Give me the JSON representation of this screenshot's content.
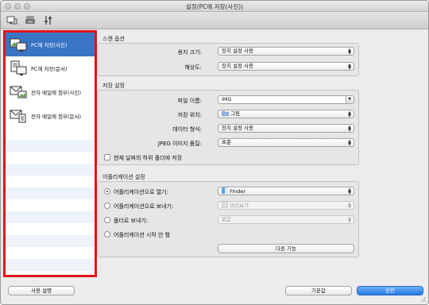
{
  "window": {
    "title": "설정(PC에 저장(사진))"
  },
  "colors": {
    "accent": "#3a75c4",
    "highlight_frame": "#e0151a"
  },
  "toolbar": {
    "icons": [
      "scan-from-computer-icon",
      "scan-from-operation-panel-icon",
      "general-settings-icon"
    ]
  },
  "sidebar": {
    "items": [
      {
        "label": "PC에 저장(사진)",
        "icon": "save-photo-icon",
        "selected": true
      },
      {
        "label": "PC에 저장(문서)",
        "icon": "save-document-icon",
        "selected": false
      },
      {
        "label": "전자 메일에 첨부(사진)",
        "icon": "email-photo-icon",
        "selected": false
      },
      {
        "label": "전자 메일에 첨부(문서)",
        "icon": "email-document-icon",
        "selected": false
      }
    ]
  },
  "scan_options": {
    "title": "스캔 옵션",
    "paper_size_label": "용지 크기:",
    "paper_size_value": "장치 설정 사용",
    "resolution_label": "해상도:",
    "resolution_value": "장치 설정 사용"
  },
  "save_settings": {
    "title": "저장 설정",
    "file_name_label": "파일 이름:",
    "file_name_value": "IMG",
    "save_in_label": "저장 위치:",
    "save_in_value": "그림",
    "data_format_label": "데이터 형식:",
    "data_format_value": "장치 설정 사용",
    "jpeg_quality_label": "JPEG 이미지 품질:",
    "jpeg_quality_value": "표준",
    "subfolder_label": "현재 날짜의 하위 폴더에 저장"
  },
  "app_settings": {
    "title": "어플리케이션 설정",
    "open_with_label": "어플리케이션으로 열기:",
    "open_with_value": "Finder",
    "send_to_app_label": "어플리케이션으로 보내기:",
    "send_to_app_value": "미리보기",
    "send_to_folder_label": "폴더로 보내기:",
    "send_to_folder_value": "없음",
    "do_not_start_label": "어플리케이션 시작 안 함",
    "more_functions_label": "다른 기능"
  },
  "footer": {
    "instructions_label": "사용 설명",
    "defaults_label": "기본값",
    "ok_label": "승인"
  }
}
